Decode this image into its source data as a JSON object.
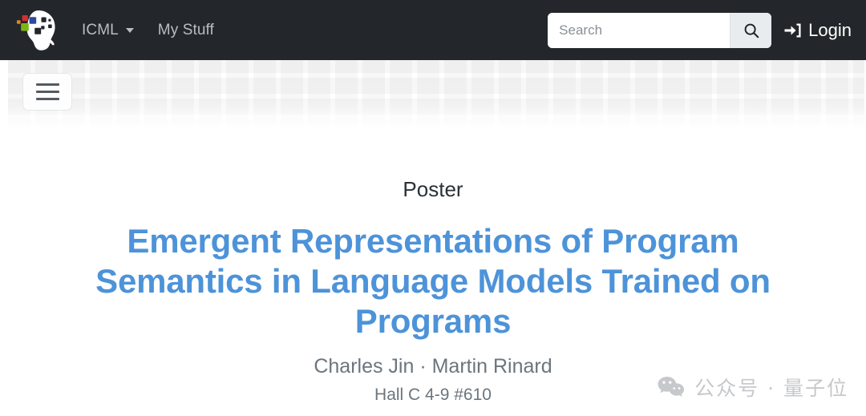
{
  "navbar": {
    "logo_name": "icml-logo",
    "logo_colors": {
      "orange": "#e8821e",
      "red": "#d32f2f",
      "blue": "#2e4a9e",
      "green": "#7cb518",
      "head": "#ffffff"
    },
    "background_color": "#23272b",
    "links": [
      {
        "label": "ICML",
        "has_caret": true
      },
      {
        "label": "My Stuff",
        "has_caret": false
      }
    ],
    "search": {
      "placeholder": "Search",
      "value": "",
      "button_icon": "search-icon"
    },
    "login": {
      "label": "Login",
      "icon": "sign-in-icon"
    }
  },
  "banner": {
    "menu_button": {
      "icon": "hamburger-icon",
      "label": "Toggle navigation"
    }
  },
  "main": {
    "event_type": "Poster",
    "title": "Emergent Representations of Program Semantics in Language Models Trained on Programs",
    "title_color": "#4d93d9",
    "authors": "Charles Jin · Martin Rinard",
    "location": "Hall C 4-9 #610"
  },
  "watermark": {
    "icon": "wechat-icon",
    "text": "公众号 · 量子位",
    "color": "#c3c6c9"
  }
}
